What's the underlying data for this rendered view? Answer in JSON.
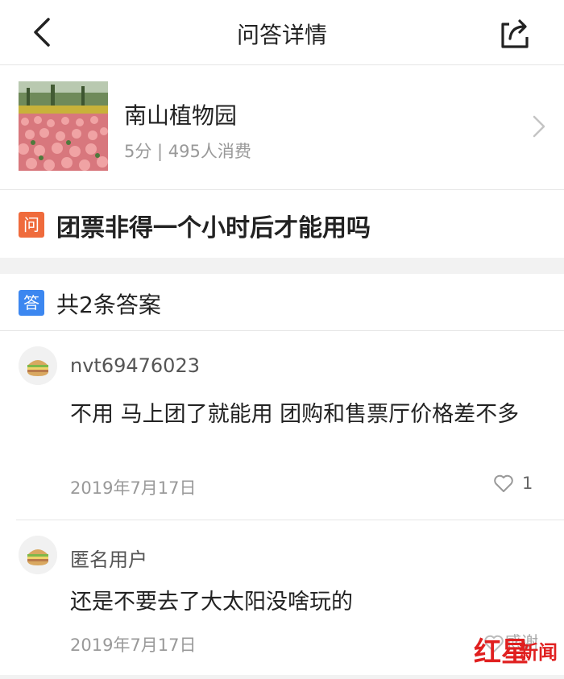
{
  "nav": {
    "title": "问答详情",
    "back_icon": "chevron-left-icon",
    "share_icon": "share-icon"
  },
  "poi": {
    "name": "南山植物园",
    "meta": "5分 | 495人消费",
    "thumbnail": "flower-field-photo"
  },
  "question": {
    "badge": "问",
    "text": "团票非得一个小时后才能用吗",
    "badge_color": "#ef6b3c"
  },
  "answers": {
    "badge": "答",
    "count_label": "共2条答案",
    "badge_color": "#3c87f0",
    "items": [
      {
        "author": "nvt69476023",
        "body": "不用 马上团了就能用 团购和售票厅价格差不多",
        "date": "2019年7月17日",
        "likes": "1"
      },
      {
        "author": "匿名用户",
        "body": "还是不要去了大太阳没啥玩的",
        "date": "2019年7月17日",
        "thanks": "感谢"
      }
    ]
  },
  "watermark": {
    "part1": "红星",
    "part2": "新闻",
    "color": "#e02020"
  }
}
